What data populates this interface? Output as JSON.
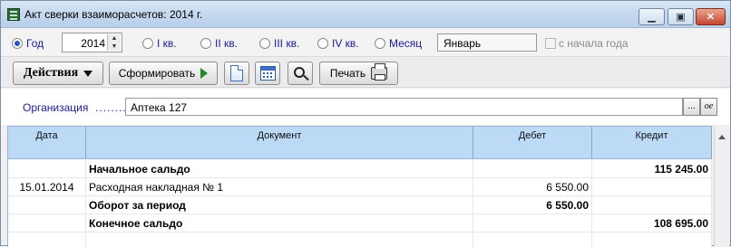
{
  "window": {
    "title": "Акт сверки взаиморасчетов: 2014 г.",
    "controls": {
      "minimize": "▁",
      "maximize": "▣",
      "close": "✕"
    }
  },
  "period": {
    "options": [
      "Год",
      "I кв.",
      "II кв.",
      "III кв.",
      "IV кв.",
      "Месяц"
    ],
    "selected": "Год",
    "year": "2014",
    "month": "Январь",
    "from_start_label": "с начала года",
    "from_start_checked": false
  },
  "toolbar": {
    "actions_label": "Действия",
    "generate_label": "Сформировать",
    "print_label": "Печать",
    "icons": [
      "document-icon",
      "calendar-icon",
      "search-icon",
      "printer-icon"
    ]
  },
  "organization": {
    "label": "Организация",
    "dots": "........",
    "value": "Аптека 127",
    "more_button": "...",
    "open_button": "ое"
  },
  "table": {
    "columns": [
      "Дата",
      "Документ",
      "Дебет",
      "Кредит"
    ],
    "rows": [
      {
        "date": "",
        "document": "Начальное сальдо",
        "debit": "",
        "credit": "115 245.00",
        "bold": true
      },
      {
        "date": "15.01.2014",
        "document": "Расходная накладная № 1",
        "debit": "6 550.00",
        "credit": "",
        "bold": false
      },
      {
        "date": "",
        "document": "Оборот за период",
        "debit": "6 550.00",
        "credit": "",
        "bold": true
      },
      {
        "date": "",
        "document": "Конечное сальдо",
        "debit": "",
        "credit": "108 695.00",
        "bold": true
      },
      {
        "date": "",
        "document": "",
        "debit": "",
        "credit": "",
        "bold": false
      }
    ]
  }
}
